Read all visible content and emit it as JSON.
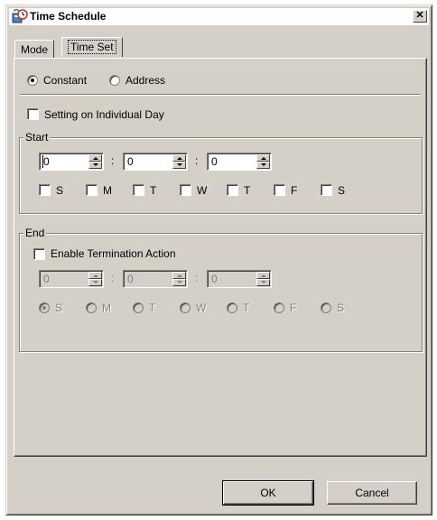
{
  "window": {
    "title": "Time Schedule",
    "close_glyph": "✕"
  },
  "tabs": [
    {
      "label": "Mode",
      "active": false
    },
    {
      "label": "Time Set",
      "active": true
    }
  ],
  "source": {
    "options": [
      {
        "label": "Constant",
        "selected": true
      },
      {
        "label": "Address",
        "selected": false
      }
    ]
  },
  "individual_day": {
    "label": "Setting on Individual Day",
    "checked": false
  },
  "start": {
    "title": "Start",
    "hour": "0",
    "minute": "0",
    "second": "0",
    "separator": ":",
    "days": [
      "S",
      "M",
      "T",
      "W",
      "T",
      "F",
      "S"
    ]
  },
  "end": {
    "title": "End",
    "enable_label": "Enable Termination Action",
    "enable_checked": false,
    "hour": "0",
    "minute": "0",
    "second": "0",
    "separator": ":",
    "days": [
      "S",
      "M",
      "T",
      "W",
      "T",
      "F",
      "S"
    ],
    "selected_day_index": 0
  },
  "buttons": {
    "ok": "OK",
    "cancel": "Cancel"
  },
  "colors": {
    "face": "#d4d0c8",
    "shadow": "#808080",
    "highlight": "#ffffff",
    "title_bg": "#ffffff"
  }
}
